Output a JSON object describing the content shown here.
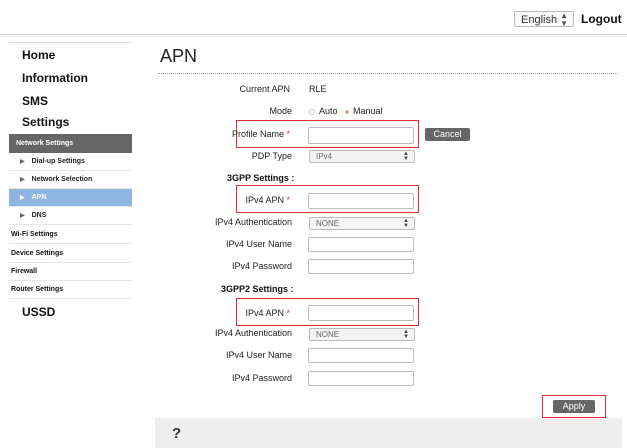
{
  "header": {
    "language": "English",
    "logout": "Logout"
  },
  "sidebar": {
    "home": "Home",
    "information": "Information",
    "sms": "SMS",
    "settings": "Settings",
    "network_settings": "Network Settings",
    "sub_items": [
      "Dial-up Settings",
      "Network Selection",
      "APN",
      "DNS"
    ],
    "items": [
      "Wi-Fi Settings",
      "Device Settings",
      "Firewall",
      "Router Settings"
    ],
    "ussd": "USSD"
  },
  "main": {
    "title": "APN",
    "current_apn_label": "Current APN",
    "current_apn_value": "RLE",
    "mode_label": "Mode",
    "mode_auto": "Auto",
    "mode_manual": "Manual",
    "profile_name_label": "Profile Name",
    "required_mark": "*",
    "cancel": "Cancel",
    "pdp_type_label": "PDP Type",
    "pdp_type_value": "IPv4",
    "gpp_title": "3GPP Settings :",
    "gpp": {
      "apn_label": "IPv4 APN",
      "auth_label": "IPv4 Authentication",
      "auth_value": "NONE",
      "user_label": "IPv4 User Name",
      "password_label": "IPv4 Password"
    },
    "gpp2_title": "3GPP2 Settings :",
    "gpp2": {
      "apn_label": "IPv4 APN",
      "auth_label": "IPv4 Authentication",
      "auth_value": "NONE",
      "user_label": "IPv4 User Name",
      "password_label": "IPv4 Password"
    },
    "apply": "Apply"
  },
  "footer": {
    "help_glyph": "?"
  },
  "colors": {
    "highlight": "#e03030",
    "active_nav": "#8fb6e3",
    "section_bg": "#666666"
  }
}
